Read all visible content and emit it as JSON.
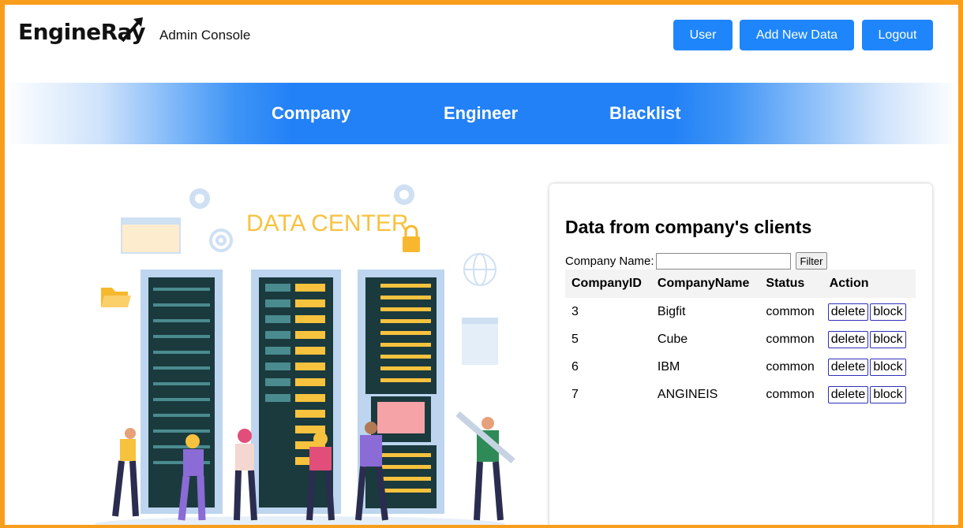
{
  "header": {
    "logo": "EngineRay",
    "subtitle": "Admin Console",
    "buttons": {
      "user": "User",
      "add": "Add New Data",
      "logout": "Logout"
    }
  },
  "nav": {
    "company": "Company",
    "engineer": "Engineer",
    "blacklist": "Blacklist"
  },
  "illustration": {
    "title": "DATA CENTER"
  },
  "panel": {
    "title": "Data from company's clients",
    "filter_label": "Company Name:",
    "filter_value": "",
    "filter_button": "Filter",
    "columns": [
      "CompanyID",
      "CompanyName",
      "Status",
      "Action"
    ],
    "rows": [
      {
        "id": "3",
        "name": "Bigfit",
        "status": "common"
      },
      {
        "id": "5",
        "name": "Cube",
        "status": "common"
      },
      {
        "id": "6",
        "name": "IBM",
        "status": "common"
      },
      {
        "id": "7",
        "name": "ANGINEIS",
        "status": "common"
      }
    ],
    "action_labels": {
      "delete": "delete",
      "block": "block"
    }
  },
  "colors": {
    "accent": "#1e86fa",
    "frame": "#f99d1c",
    "nav": "#2381f7"
  }
}
